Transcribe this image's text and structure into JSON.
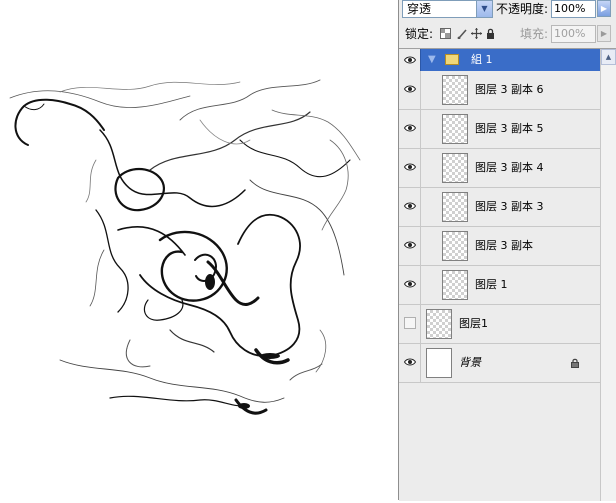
{
  "blend": {
    "mode": "穿透",
    "opacity_label": "不透明度:",
    "opacity_value": "100%"
  },
  "lock": {
    "label": "锁定:",
    "fill_label": "填充:",
    "fill_value": "100%"
  },
  "layers": {
    "group": {
      "name": "組 1",
      "visible": true,
      "expanded": true
    },
    "items": [
      {
        "name": "图层 3 副本 6",
        "visible": true
      },
      {
        "name": "图层 3 副本 5",
        "visible": true
      },
      {
        "name": "图层 3 副本 4",
        "visible": true
      },
      {
        "name": "图层 3 副本 3",
        "visible": true
      },
      {
        "name": "图层 3 副本",
        "visible": true
      },
      {
        "name": "图层 1",
        "visible": true
      },
      {
        "name": "图层1",
        "visible": false
      },
      {
        "name": "背景",
        "visible": true,
        "locked": true
      }
    ]
  },
  "icons": {
    "eye": "eye-icon",
    "folder": "folder-icon",
    "lock": "lock-icon",
    "dropdown": "chevron-down-icon",
    "flyout": "chevron-right-icon"
  },
  "colors": {
    "selected_row": "#3a6dc8",
    "panel_bg": "#ececec",
    "canvas_bg": "#ffffff"
  }
}
